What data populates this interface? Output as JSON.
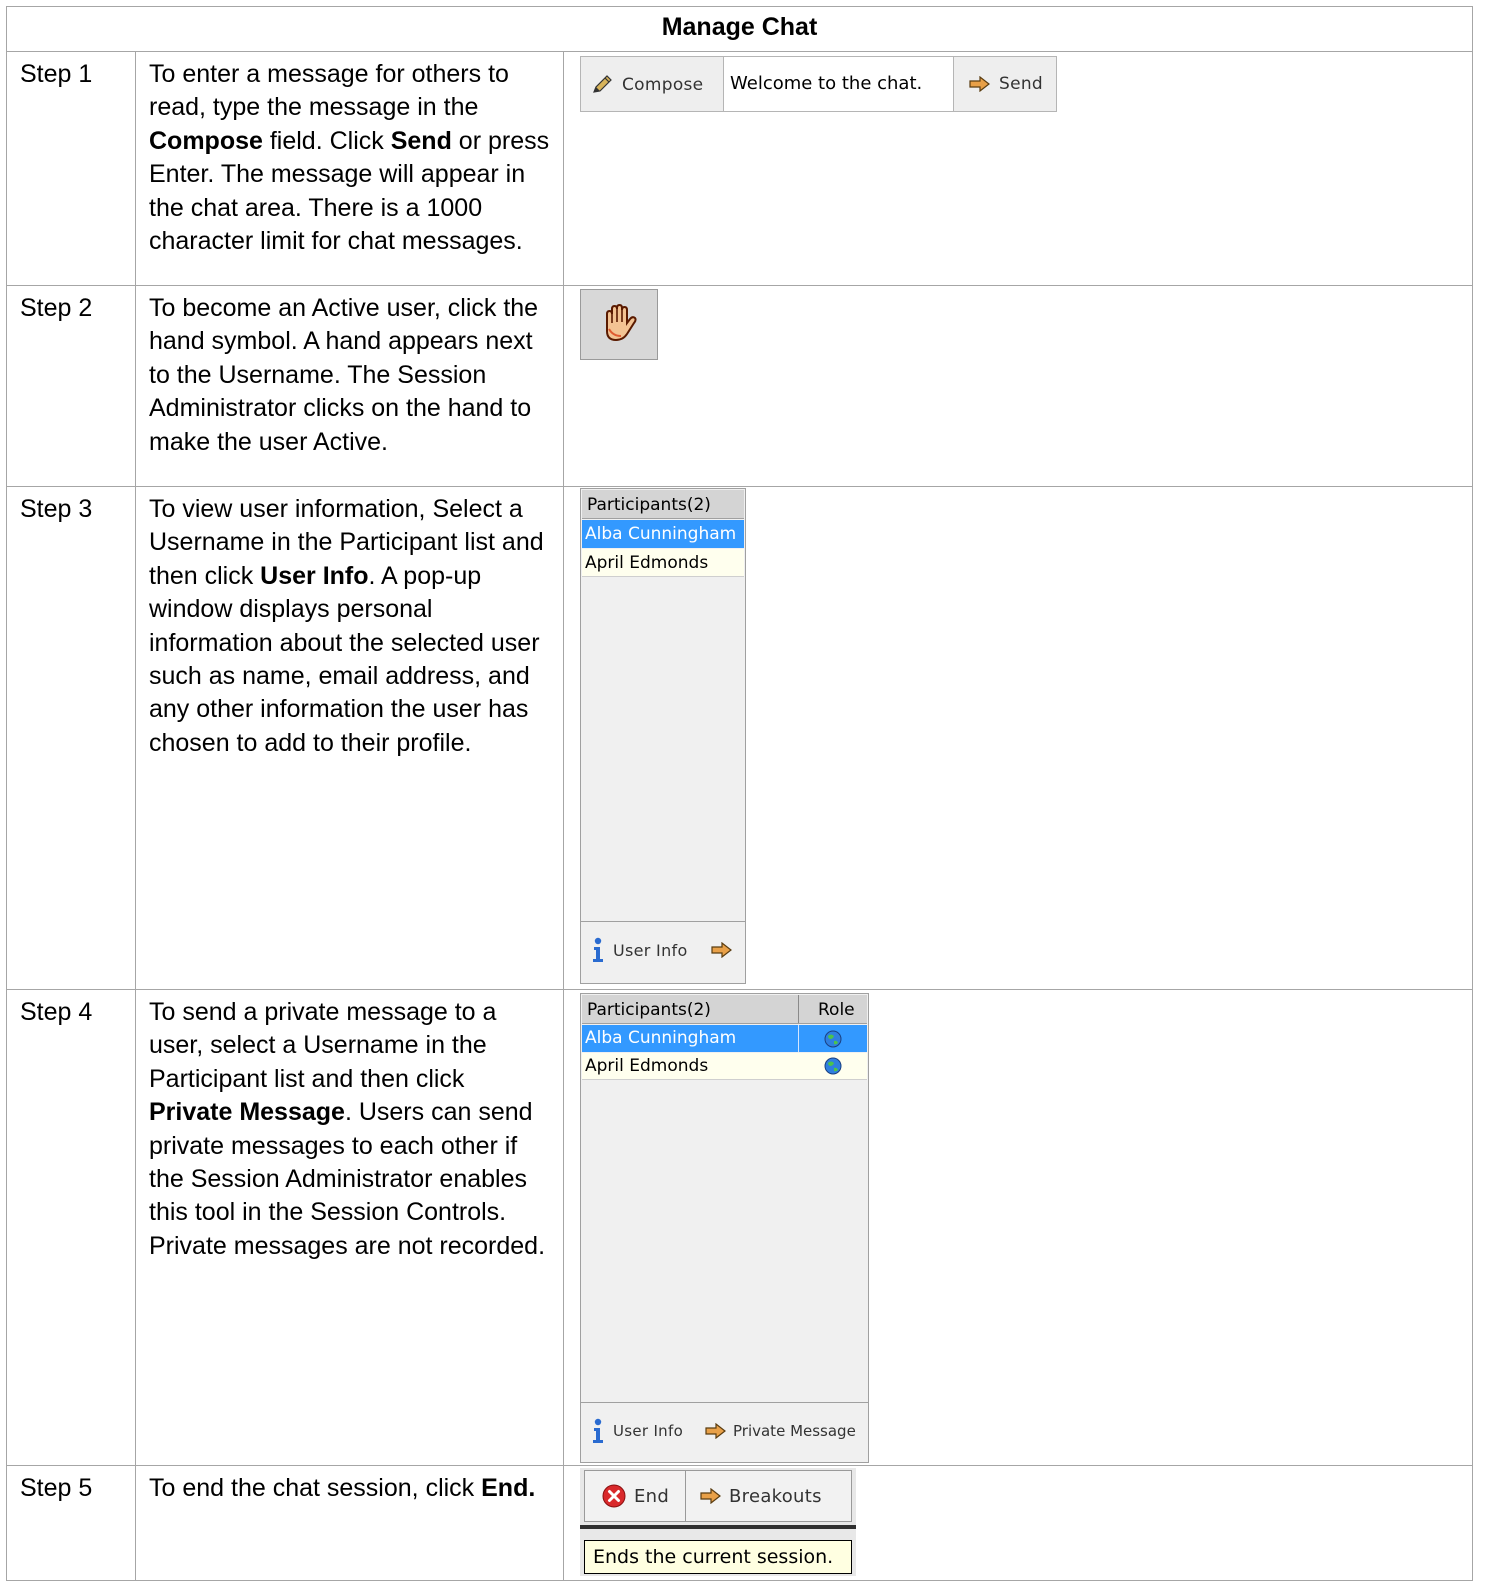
{
  "document": {
    "title": "Manage Chat",
    "steps": [
      {
        "label": "Step 1",
        "text": [
          {
            "t": "To enter a message for others to read, type the message in the ",
            "b": false
          },
          {
            "t": "Compose",
            "b": true
          },
          {
            "t": " field. Click ",
            "b": false
          },
          {
            "t": "Send",
            "b": true
          },
          {
            "t": " or press Enter. The message will appear in the chat area. There is a 1000 character limit for chat messages.",
            "b": false
          }
        ]
      },
      {
        "label": "Step 2",
        "text": [
          {
            "t": "To become an Active user, click the hand symbol. A hand appears next to the Username.  The Session Administrator clicks on the hand to make the user Active.",
            "b": false
          }
        ]
      },
      {
        "label": "Step 3",
        "text": [
          {
            "t": "To view user information, Select a Username in the Participant list and then click ",
            "b": false
          },
          {
            "t": "User Info",
            "b": true
          },
          {
            "t": ". A pop-up window displays personal information about the selected user such as name, email address, and any other information the user has chosen to add to their profile.",
            "b": false
          }
        ]
      },
      {
        "label": "Step 4",
        "text": [
          {
            "t": "To send a private message to a user, select a Username in the Participant list and then click ",
            "b": false
          },
          {
            "t": "Private Message",
            "b": true
          },
          {
            "t": ". Users can send private messages to each other if the Session Administrator enables this tool in the Session Controls. Private messages are not recorded.",
            "b": false
          }
        ]
      },
      {
        "label": "Step 5",
        "text": [
          {
            "t": "To end the chat session, click ",
            "b": false
          },
          {
            "t": "End.",
            "b": true
          }
        ]
      }
    ]
  },
  "compose_bar": {
    "compose_label": "Compose",
    "input_value": "Welcome to the chat.",
    "send_label": "Send"
  },
  "participants_panel_1": {
    "header": "Participants(2)",
    "rows": [
      "Alba Cunningham",
      "April Edmonds"
    ],
    "selected_index": 0,
    "user_info_label": "User Info"
  },
  "participants_panel_2": {
    "header": "Participants(2)",
    "role_header": "Role",
    "rows": [
      "Alba Cunningham",
      "April Edmonds"
    ],
    "selected_index": 0,
    "user_info_label": "User Info",
    "private_message_label": "Private Message"
  },
  "session_buttons": {
    "end_label": "End",
    "breakouts_label": "Breakouts",
    "tooltip": "Ends the current session."
  },
  "icons": {
    "compose": "pencil-icon",
    "send": "arrow-right-icon",
    "raise_hand": "hand-icon",
    "user_info": "info-icon",
    "role": "globe-icon",
    "end": "stop-x-icon"
  },
  "colors": {
    "selected_row": "#3399ff",
    "unselected_row": "#ffffee",
    "panel_bg": "#f0f0f0",
    "arrow_fill": "#e8a048"
  }
}
